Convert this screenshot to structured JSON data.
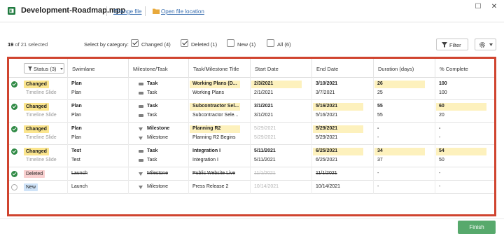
{
  "window": {
    "file_name": "Development-Roadmap.mpp",
    "change_file": "Change file",
    "open_location": "Open file location",
    "maximize": "☐",
    "close": "✕"
  },
  "selection": {
    "count": "19",
    "suffix": "of 21 selected"
  },
  "categories": {
    "label": "Select by category:",
    "options": [
      {
        "label": "Changed (4)",
        "checked": true
      },
      {
        "label": "Deleted (1)",
        "checked": true
      },
      {
        "label": "New (1)",
        "checked": false
      },
      {
        "label": "All (6)",
        "checked": false
      }
    ]
  },
  "toolbar": {
    "filter": "Filter"
  },
  "columns": {
    "status": "Status (3)",
    "swimlane": "Swimlane",
    "milestone_task": "Milestone/Task",
    "title": "Task/Milestone Title",
    "start": "Start Date",
    "end": "End Date",
    "duration": "Duration (days)",
    "complete": "% Complete"
  },
  "rows": [
    {
      "status": "Changed",
      "checked": true,
      "swimlane": "Plan",
      "type": "Task",
      "title": "Working Plans (D...",
      "start": "2/3/2021",
      "end": "3/10/2021",
      "duration": "26",
      "complete": "100",
      "sub": {
        "label": "Timeline Slide",
        "swimlane": "Plan",
        "type": "Task",
        "title": "Working Plans",
        "start": "2/1/2021",
        "end": "3/7/2021",
        "duration": "25",
        "complete": "100"
      }
    },
    {
      "status": "Changed",
      "checked": true,
      "swimlane": "Plan",
      "type": "Task",
      "title": "Subcontractor Sel...",
      "start": "3/1/2021",
      "end": "5/16/2021",
      "duration": "55",
      "complete": "60",
      "sub": {
        "label": "Timeline Slide",
        "swimlane": "Plan",
        "type": "Task",
        "title": "Subcontractor Sele...",
        "start": "3/1/2021",
        "end": "5/16/2021",
        "duration": "55",
        "complete": "20"
      }
    },
    {
      "status": "Changed",
      "checked": true,
      "swimlane": "Plan",
      "type": "Milestone",
      "title": "Planning R2",
      "start": "5/29/2021",
      "end": "5/29/2021",
      "duration": "-",
      "complete": "-",
      "sub": {
        "label": "Timeline Slide",
        "swimlane": "Plan",
        "type": "Milestone",
        "title": "Planning R2 Begins",
        "start": "5/29/2021",
        "end": "5/29/2021",
        "duration": "-",
        "complete": "-"
      }
    },
    {
      "status": "Changed",
      "checked": true,
      "swimlane": "Test",
      "type": "Task",
      "title": "Integration I",
      "start": "5/11/2021",
      "end": "6/25/2021",
      "duration": "34",
      "complete": "54",
      "sub": {
        "label": "Timeline Slide",
        "swimlane": "Test",
        "type": "Task",
        "title": "Integration I",
        "start": "5/11/2021",
        "end": "6/25/2021",
        "duration": "37",
        "complete": "50"
      }
    },
    {
      "status": "Deleted",
      "checked": true,
      "swimlane": "Launch",
      "type": "Milestone",
      "title": "Public Website Live",
      "start": "11/1/2021",
      "end": "11/1/2021",
      "duration": "-",
      "complete": "-"
    },
    {
      "status": "New",
      "checked": false,
      "swimlane": "Launch",
      "type": "Milestone",
      "title": "Press Release 2",
      "start": "10/14/2021",
      "end": "10/14/2021",
      "duration": "-",
      "complete": "-"
    }
  ],
  "footer": {
    "finish": "Finish"
  },
  "colors": {
    "accent_red": "#d0442f",
    "changed": "#fbe58d",
    "deleted": "#f9d0d0",
    "new": "#cfe3f8",
    "finish": "#57a96c",
    "check_green": "#2f8a45"
  }
}
